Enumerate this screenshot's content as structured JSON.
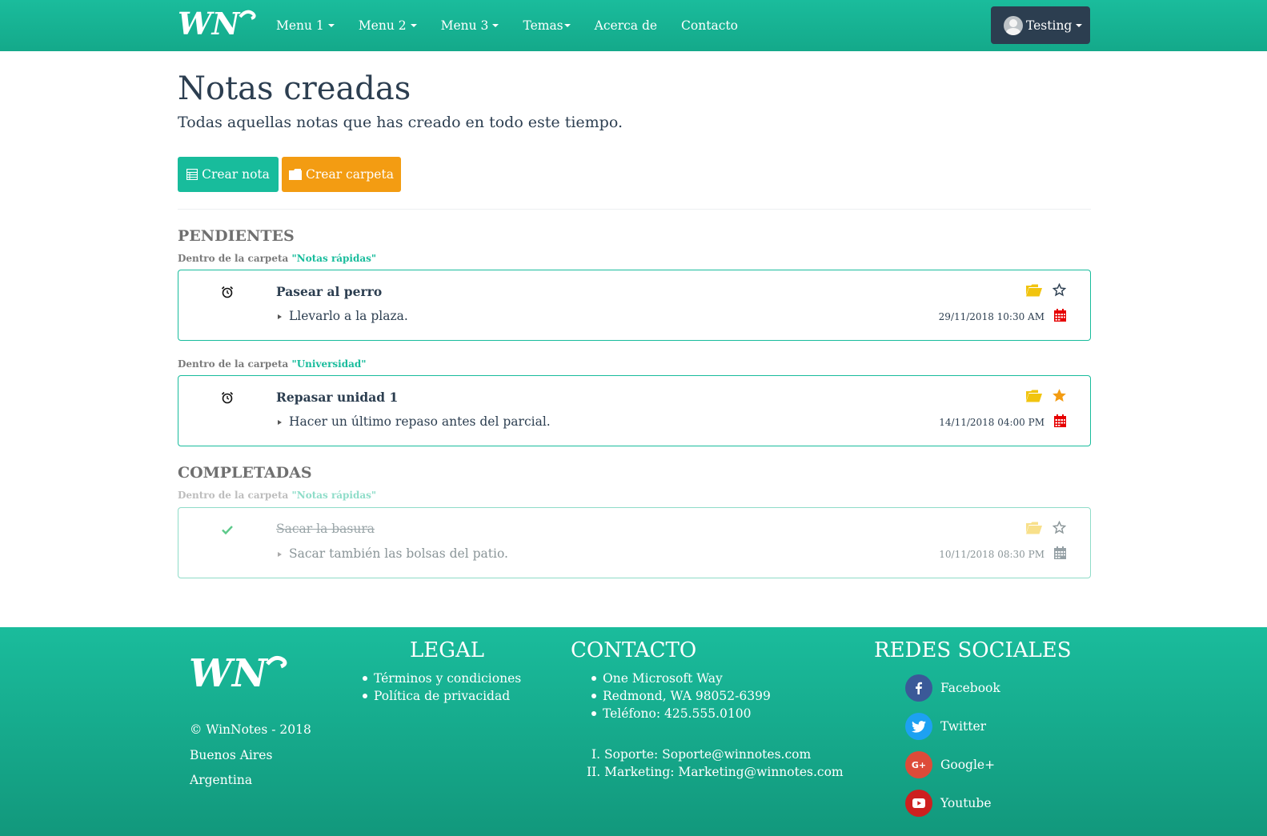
{
  "nav": {
    "logo_text": "WN",
    "items": [
      {
        "label": "Menu 1",
        "dropdown": true
      },
      {
        "label": "Menu 2",
        "dropdown": true
      },
      {
        "label": "Menu 3",
        "dropdown": true
      },
      {
        "label": "Temas",
        "dropdown": true
      },
      {
        "label": "Acerca de",
        "dropdown": false
      },
      {
        "label": "Contacto",
        "dropdown": false
      }
    ],
    "user": "Testing"
  },
  "header": {
    "title": "Notas creadas",
    "subtitle": "Todas aquellas notas que has creado en todo este tiempo."
  },
  "actions": {
    "create_note": "Crear nota",
    "create_folder": "Crear carpeta"
  },
  "sections": {
    "pending": {
      "title": "PENDIENTES",
      "groups": [
        {
          "folder_prefix": "Dentro de la carpeta",
          "folder_name": "\"Notas rápidas\"",
          "note": {
            "title": "Pasear al perro",
            "desc": "Llevarlo a la plaza.",
            "date": "29/11/2018 10:30 AM",
            "starred": false,
            "status_icon": "alarm-clock-icon"
          }
        },
        {
          "folder_prefix": "Dentro de la carpeta",
          "folder_name": "\"Universidad\"",
          "note": {
            "title": "Repasar unidad 1",
            "desc": "Hacer un último repaso antes del parcial.",
            "date": "14/11/2018 04:00 PM",
            "starred": true,
            "status_icon": "alarm-clock-icon"
          }
        }
      ]
    },
    "completed": {
      "title": "COMPLETADAS",
      "groups": [
        {
          "folder_prefix": "Dentro de la carpeta",
          "folder_name": "\"Notas rápidas\"",
          "note": {
            "title": "Sacar la basura",
            "desc": "Sacar también las bolsas del patio.",
            "date": "10/11/2018 08:30 PM",
            "starred": false,
            "status_icon": "check-icon"
          }
        }
      ]
    }
  },
  "footer": {
    "copyright": "© WinNotes - 2018",
    "city": "Buenos Aires",
    "country": "Argentina",
    "legal": {
      "title": "LEGAL",
      "items": [
        "Términos y condiciones",
        "Política de privacidad"
      ]
    },
    "contact": {
      "title": "CONTACTO",
      "items": [
        "One Microsoft Way",
        "Redmond, WA 98052-6399",
        "Teléfono: 425.555.0100"
      ],
      "numbered": [
        "I. Soporte: Soporte@winnotes.com",
        "II. Marketing: Marketing@winnotes.com"
      ]
    },
    "social": {
      "title": "REDES SOCIALES",
      "items": [
        {
          "label": "Facebook",
          "icon": "facebook-icon",
          "color": "#3b5998"
        },
        {
          "label": "Twitter",
          "icon": "twitter-icon",
          "color": "#1da1f2"
        },
        {
          "label": "Google+",
          "icon": "google-plus-icon",
          "color": "#dd4b39"
        },
        {
          "label": "Youtube",
          "icon": "youtube-icon",
          "color": "#cd201f"
        }
      ]
    }
  },
  "colors": {
    "brand": "#1abc9c",
    "dark": "#2c3e50",
    "warning": "#f39c12",
    "danger": "#e60000"
  }
}
